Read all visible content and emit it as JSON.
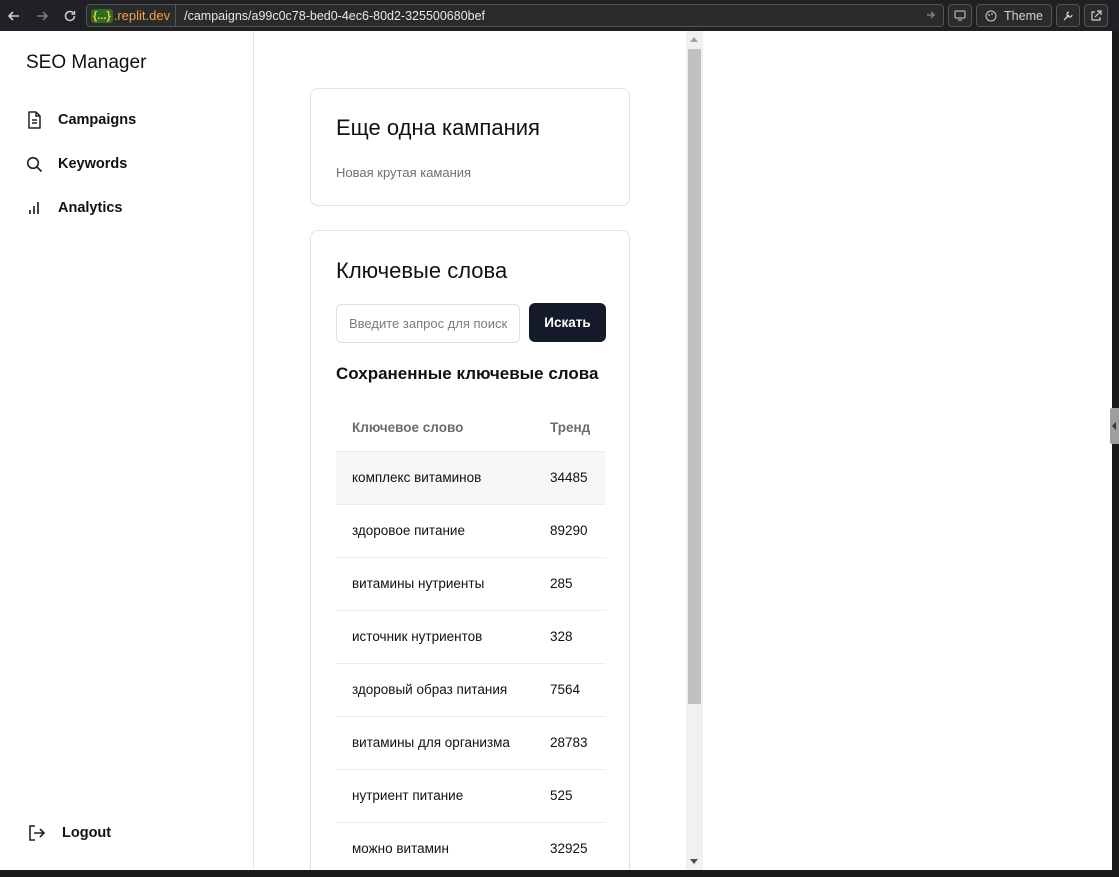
{
  "browser": {
    "domain_logo": "{...}",
    "domain": ".replit.dev",
    "path": "/campaigns/a99c0c78-bed0-4ec6-80d2-325500680bef",
    "theme_label": "Theme"
  },
  "sidebar": {
    "brand": "SEO Manager",
    "items": [
      {
        "label": "Campaigns",
        "icon": "document-icon"
      },
      {
        "label": "Keywords",
        "icon": "search-icon"
      },
      {
        "label": "Analytics",
        "icon": "bar-chart-icon"
      }
    ],
    "logout": {
      "label": "Logout",
      "icon": "logout-icon"
    }
  },
  "campaign": {
    "title": "Еще одна кампания",
    "description": "Новая крутая камания"
  },
  "keywords": {
    "title": "Ключевые слова",
    "search": {
      "placeholder": "Введите запрос для поиска",
      "button": "Искать"
    },
    "saved_title": "Сохраненные ключевые слова",
    "columns": [
      "Ключевое слово",
      "Тренд"
    ],
    "rows": [
      {
        "keyword": "комплекс витаминов",
        "trend": "34485"
      },
      {
        "keyword": "здоровое питание",
        "trend": "89290"
      },
      {
        "keyword": "витамины нутриенты",
        "trend": "285"
      },
      {
        "keyword": "источник нутриентов",
        "trend": "328"
      },
      {
        "keyword": "здоровый образ питания",
        "trend": "7564"
      },
      {
        "keyword": "витамины для организма",
        "trend": "28783"
      },
      {
        "keyword": "нутриент питание",
        "trend": "525"
      },
      {
        "keyword": "можно витамин",
        "trend": "32925"
      }
    ]
  },
  "colors": {
    "primary_button": "#151a2b",
    "domain_accent": "#f0a24a"
  }
}
